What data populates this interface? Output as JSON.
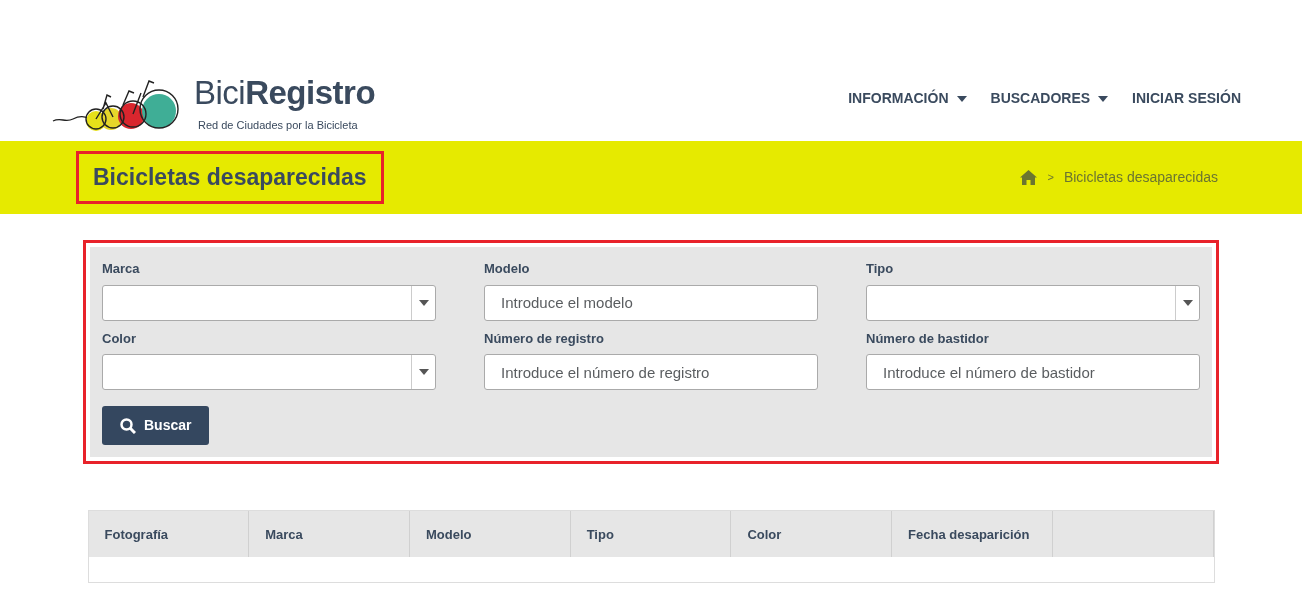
{
  "logo": {
    "title": "Bici**Registro**",
    "subtitle": "Red de Ciudades por la Bicicleta"
  },
  "nav": [
    {
      "label": "INFORMACIÓN",
      "dropdown": true
    },
    {
      "label": "BUSCADORES",
      "dropdown": true
    },
    {
      "label": "INICIAR SESIÓN",
      "dropdown": false
    }
  ],
  "page_title": "Bicicletas desaparecidas",
  "breadcrumb": {
    "separator": ">",
    "current": "Bicicletas desaparecidas"
  },
  "filters": [
    {
      "label": "Marca",
      "kind": "select"
    },
    {
      "label": "Modelo",
      "kind": "text",
      "placeholder": "Introduce el modelo"
    },
    {
      "label": "Tipo",
      "kind": "select"
    },
    {
      "label": "Color",
      "kind": "select"
    },
    {
      "label": "Número de registro",
      "kind": "text",
      "placeholder": "Introduce el número de registro"
    },
    {
      "label": "Número de bastidor",
      "kind": "text",
      "placeholder": "Introduce el número de bastidor"
    }
  ],
  "search_button": "Buscar",
  "table": {
    "columns": [
      "Fotografía",
      "Marca",
      "Modelo",
      "Tipo",
      "Color",
      "Fecha desaparición",
      ""
    ]
  }
}
